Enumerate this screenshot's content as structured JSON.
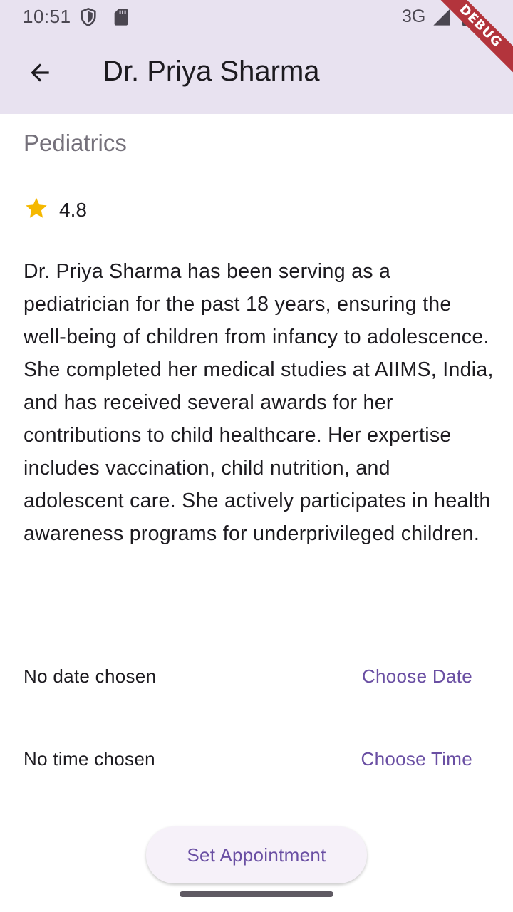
{
  "status_bar": {
    "time": "10:51",
    "network": "3G",
    "icons": [
      "shield-icon",
      "sd-card-icon",
      "signal-icon",
      "battery-icon"
    ]
  },
  "app_bar": {
    "back_icon": "arrow-back-icon",
    "title": "Dr. Priya Sharma",
    "debug_banner": "DEBUG"
  },
  "doctor": {
    "specialty": "Pediatrics",
    "rating": "4.8",
    "rating_icon": "star-icon",
    "bio": "Dr. Priya Sharma has been serving as a pediatrician for the past 18 years, ensuring the well-being of children from infancy to adolescence. She completed her medical studies at AIIMS, India, and has received several awards for her contributions to child healthcare. Her expertise includes vaccination, child nutrition, and adolescent care. She actively participates in health awareness programs for underprivileged children."
  },
  "appointment": {
    "date_label": "No date chosen",
    "date_button": "Choose Date",
    "time_label": "No time chosen",
    "time_button": "Choose Time",
    "submit_button": "Set Appointment"
  },
  "colors": {
    "app_bar_bg": "#e8e2f0",
    "accent": "#6a4fa3",
    "star": "#f5b800",
    "debug_banner": "#b3343c"
  }
}
